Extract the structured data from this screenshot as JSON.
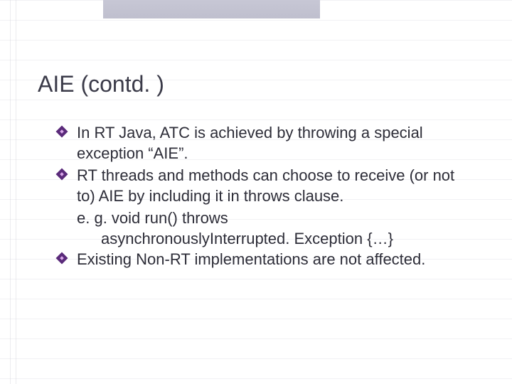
{
  "title": "AIE (contd. )",
  "bullets": {
    "b1": " In RT Java, ATC is achieved by throwing a special exception “AIE”.",
    "b2": " RT threads and methods can choose to receive (or not to) AIE by including it in throws clause.",
    "b2_sub1": "e. g. void run() throws",
    "b2_sub2": "asynchronouslyInterrupted. Exception {…}",
    "b3": " Existing Non-RT implementations are not affected."
  }
}
